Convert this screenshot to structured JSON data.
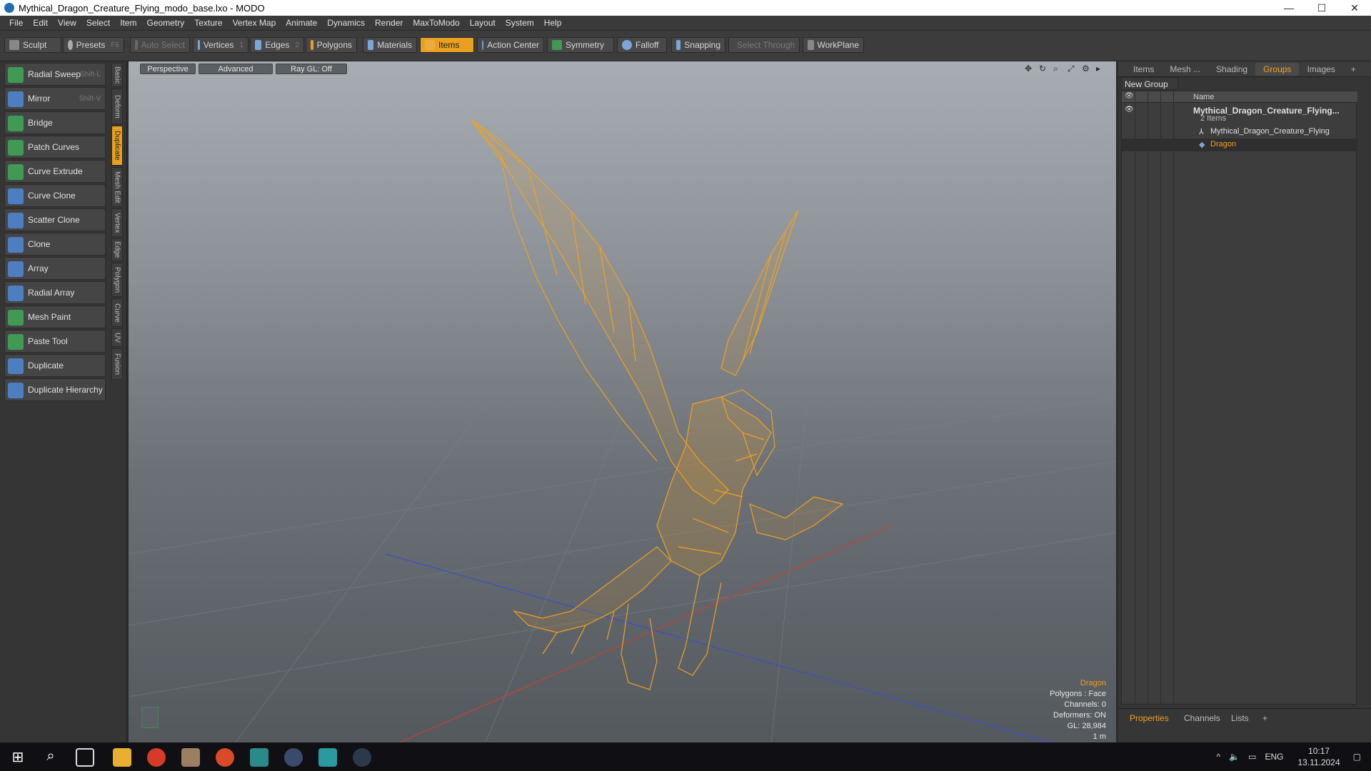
{
  "window": {
    "title": "Mythical_Dragon_Creature_Flying_modo_base.lxo - MODO",
    "minimize": "—",
    "maximize": "☐",
    "close": "✕"
  },
  "menu": [
    "File",
    "Edit",
    "View",
    "Select",
    "Item",
    "Geometry",
    "Texture",
    "Vertex Map",
    "Animate",
    "Dynamics",
    "Render",
    "MaxToModo",
    "Layout",
    "System",
    "Help"
  ],
  "toolbar": {
    "sculpt": "Sculpt",
    "presets": "Presets",
    "presets_key": "F6",
    "auto_select": "Auto Select",
    "vertices": "Vertices",
    "vertices_count": "1",
    "edges": "Edges",
    "edges_count": "2",
    "polygons": "Polygons",
    "materials": "Materials",
    "items": "Items",
    "action_center": "Action Center",
    "symmetry": "Symmetry",
    "falloff": "Falloff",
    "snapping": "Snapping",
    "select_through": "Select Through",
    "workplane": "WorkPlane"
  },
  "tools": [
    {
      "label": "Radial Sweep",
      "shortcut": "Shift-L",
      "icon": "radial-sweep-icon",
      "color": "#3f9a54"
    },
    {
      "label": "Mirror",
      "shortcut": "Shift-V",
      "icon": "mirror-icon",
      "color": "#4d7fc0"
    },
    {
      "label": "Bridge",
      "shortcut": "",
      "icon": "bridge-icon",
      "color": "#3f9a54"
    },
    {
      "label": "Patch Curves",
      "shortcut": "",
      "icon": "patch-curves-icon",
      "color": "#3f9a54"
    },
    {
      "label": "Curve Extrude",
      "shortcut": "",
      "icon": "curve-extrude-icon",
      "color": "#3f9a54"
    },
    {
      "label": "Curve Clone",
      "shortcut": "",
      "icon": "curve-clone-icon",
      "color": "#4d7fc0"
    },
    {
      "label": "Scatter Clone",
      "shortcut": "",
      "icon": "scatter-clone-icon",
      "color": "#4d7fc0"
    },
    {
      "label": "Clone",
      "shortcut": "",
      "icon": "clone-icon",
      "color": "#4d7fc0"
    },
    {
      "label": "Array",
      "shortcut": "",
      "icon": "array-icon",
      "color": "#4d7fc0"
    },
    {
      "label": "Radial Array",
      "shortcut": "",
      "icon": "radial-array-icon",
      "color": "#4d7fc0"
    },
    {
      "label": "Mesh Paint",
      "shortcut": "",
      "icon": "mesh-paint-icon",
      "color": "#3f9a54"
    },
    {
      "label": "Paste Tool",
      "shortcut": "",
      "icon": "paste-tool-icon",
      "color": "#3f9a54"
    },
    {
      "label": "Duplicate",
      "shortcut": "",
      "icon": "duplicate-icon",
      "color": "#4d7fc0"
    },
    {
      "label": "Duplicate Hierarchy",
      "shortcut": "",
      "icon": "duplicate-hierarchy-icon",
      "color": "#4d7fc0"
    }
  ],
  "vtabs": [
    "Basic",
    "Deform",
    "Duplicate",
    "Mesh Edit",
    "Vertex",
    "Edge",
    "Polygon",
    "Curve",
    "UV",
    "Fusion"
  ],
  "viewport": {
    "tabs": [
      "Perspective",
      "Advanced",
      "Ray GL: Off"
    ],
    "info": {
      "selected": "Dragon",
      "polygons": "Polygons : Face",
      "channels": "Channels: 0",
      "deformers": "Deformers: ON",
      "gl": "GL: 28,984",
      "scale": "1 m"
    }
  },
  "right_panel": {
    "tabs": [
      "Items",
      "Mesh ...",
      "Shading",
      "Groups",
      "Images"
    ],
    "active_tab": "Groups",
    "new_group": "New Group",
    "name_header": "Name",
    "rows": [
      {
        "label": "Mythical_Dragon_Creature_Flying...",
        "sub": "2 Items"
      },
      {
        "label": "Mythical_Dragon_Creature_Flying"
      },
      {
        "label": "Dragon"
      }
    ],
    "bottom_tabs": [
      "Properties",
      "Channels",
      "Lists"
    ]
  },
  "taskbar": {
    "lang": "ENG",
    "time": "10:17",
    "date": "13.11.2024"
  },
  "colors": {
    "accent": "#e8a020",
    "wireframe": "#f0a020"
  }
}
